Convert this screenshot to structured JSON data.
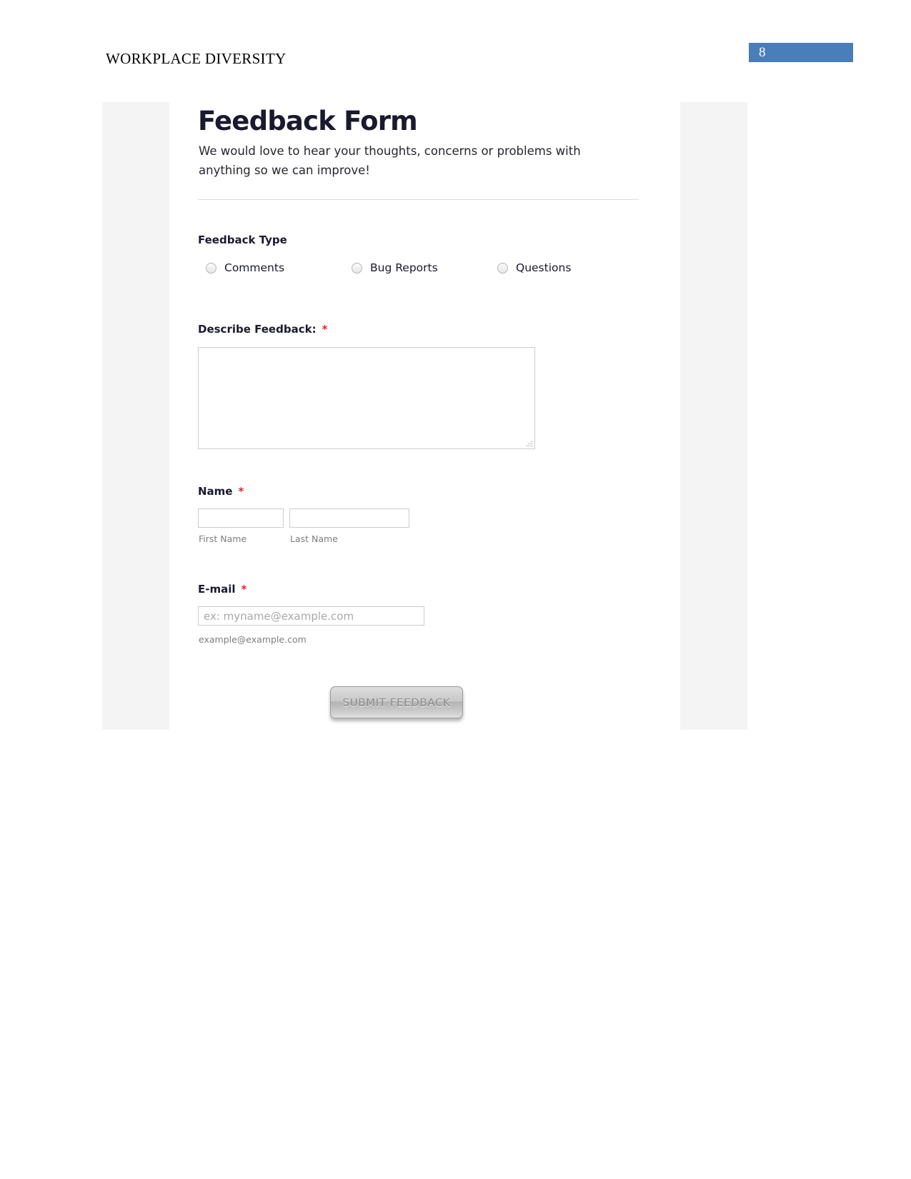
{
  "document": {
    "running_head": "WORKPLACE DIVERSITY",
    "page_number": "8",
    "page_number_bg": "#4a7ebb"
  },
  "form": {
    "title": "Feedback Form",
    "subtitle": "We would love to hear your thoughts, concerns or problems with anything so we can improve!",
    "feedback_type": {
      "label": "Feedback Type",
      "options": [
        {
          "label": "Comments",
          "selected": false
        },
        {
          "label": "Bug Reports",
          "selected": false
        },
        {
          "label": "Questions",
          "selected": false
        }
      ]
    },
    "describe": {
      "label": "Describe Feedback:",
      "required_marker": "*",
      "value": "",
      "placeholder": ""
    },
    "name": {
      "label": "Name",
      "required_marker": "*",
      "first": {
        "value": "",
        "sublabel": "First Name"
      },
      "last": {
        "value": "",
        "sublabel": "Last Name"
      }
    },
    "email": {
      "label": "E-mail",
      "required_marker": "*",
      "value": "",
      "placeholder": "ex: myname@example.com",
      "hint": "example@example.com"
    },
    "submit": {
      "label": "SUBMIT FEEDBACK"
    },
    "colors": {
      "required_star": "#e3242b",
      "field_border": "#cccccc",
      "gutter": "#f4f4f4"
    }
  }
}
